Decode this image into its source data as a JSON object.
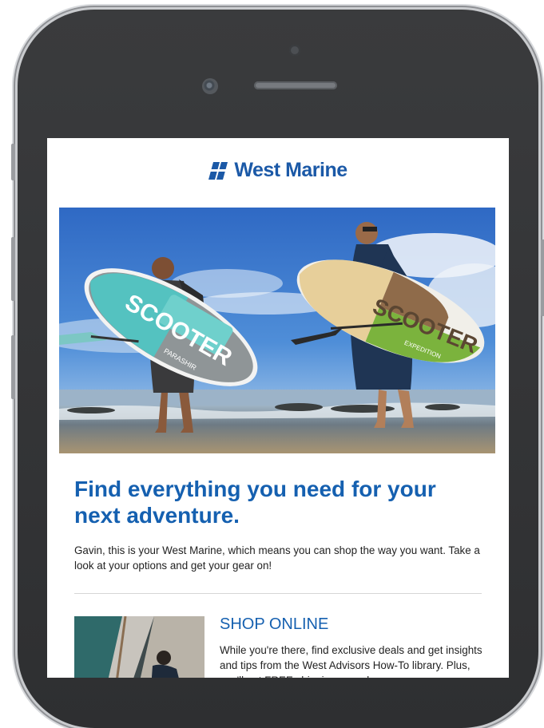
{
  "brand": {
    "logo_text": "West Marine",
    "color": "#1b59a7"
  },
  "hero": {
    "board_left_text": "SCOOTER",
    "board_left_sub": "PARASHIR",
    "board_right_text": "SCOOTER",
    "board_right_sub": "EXPEDITION"
  },
  "email": {
    "headline": "Find everything you need for your next adventure.",
    "intro": "Gavin, this is your West Marine, which means you can shop the way you want. Take a look at your options and get your gear on!",
    "shop_online_title": "SHOP ONLINE",
    "shop_online_body": "While you're there, find exclusive deals and get insights and tips from the West Advisors How-To library. Plus, you'll get FREE shipping on orders"
  },
  "colors": {
    "accent": "#1560b0",
    "phone_frame": "#2e2f31"
  }
}
